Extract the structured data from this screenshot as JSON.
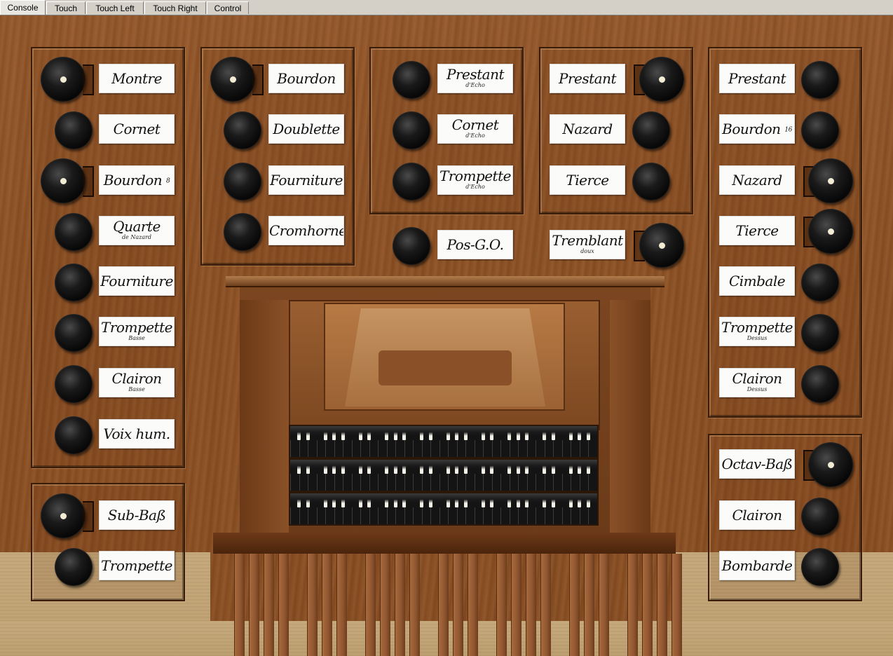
{
  "tabs": [
    {
      "label": "Console",
      "active": true
    },
    {
      "label": "Touch",
      "active": false
    },
    {
      "label": "Touch Left",
      "active": false
    },
    {
      "label": "Touch Right",
      "active": false
    },
    {
      "label": "Control",
      "active": false
    }
  ],
  "panels": {
    "grand_orgue": {
      "stops": [
        {
          "name": "Montre",
          "on": true
        },
        {
          "name": "Cornet",
          "on": false
        },
        {
          "name": "Bourdon",
          "num": "8",
          "on": true
        },
        {
          "name": "Quarte",
          "sub": "de Nazard",
          "on": false
        },
        {
          "name": "Fourniture",
          "on": false
        },
        {
          "name": "Trompette",
          "sub": "Basse",
          "on": false
        },
        {
          "name": "Clairon",
          "sub": "Basse",
          "on": false
        },
        {
          "name": "Voix hum.",
          "on": false
        }
      ]
    },
    "pedale_left": {
      "stops": [
        {
          "name": "Sub-Baß",
          "on": true
        },
        {
          "name": "Trompette",
          "on": false
        }
      ]
    },
    "positif": {
      "stops": [
        {
          "name": "Bourdon",
          "on": true
        },
        {
          "name": "Doublette",
          "on": false
        },
        {
          "name": "Fourniture",
          "on": false
        },
        {
          "name": "Cromhorne",
          "on": false
        }
      ]
    },
    "echo": {
      "stops": [
        {
          "name": "Prestant",
          "sub": "d'Echo",
          "on": false
        },
        {
          "name": "Cornet",
          "sub": "d'Echo",
          "on": false
        },
        {
          "name": "Trompette",
          "sub": "d'Echo",
          "on": false
        }
      ]
    },
    "recit": {
      "stops": [
        {
          "name": "Prestant",
          "on": true
        },
        {
          "name": "Nazard",
          "on": false
        },
        {
          "name": "Tierce",
          "on": false
        }
      ]
    },
    "center": {
      "coupler": {
        "name": "Pos-G.O.",
        "on": false
      },
      "tremulant": {
        "name": "Tremblant",
        "sub": "doux",
        "on": true
      }
    },
    "right_upper": {
      "stops": [
        {
          "name": "Prestant",
          "on": false
        },
        {
          "name": "Bourdon",
          "num": "16",
          "on": false
        },
        {
          "name": "Nazard",
          "on": true
        },
        {
          "name": "Tierce",
          "on": true
        },
        {
          "name": "Cimbale",
          "on": false
        },
        {
          "name": "Trompette",
          "sub": "Dessus",
          "on": false
        },
        {
          "name": "Clairon",
          "sub": "Dessus",
          "on": false
        }
      ]
    },
    "pedale_right": {
      "stops": [
        {
          "name": "Octav-Baß",
          "on": true
        },
        {
          "name": "Clairon",
          "on": false
        },
        {
          "name": "Bombarde",
          "on": false
        }
      ]
    }
  }
}
